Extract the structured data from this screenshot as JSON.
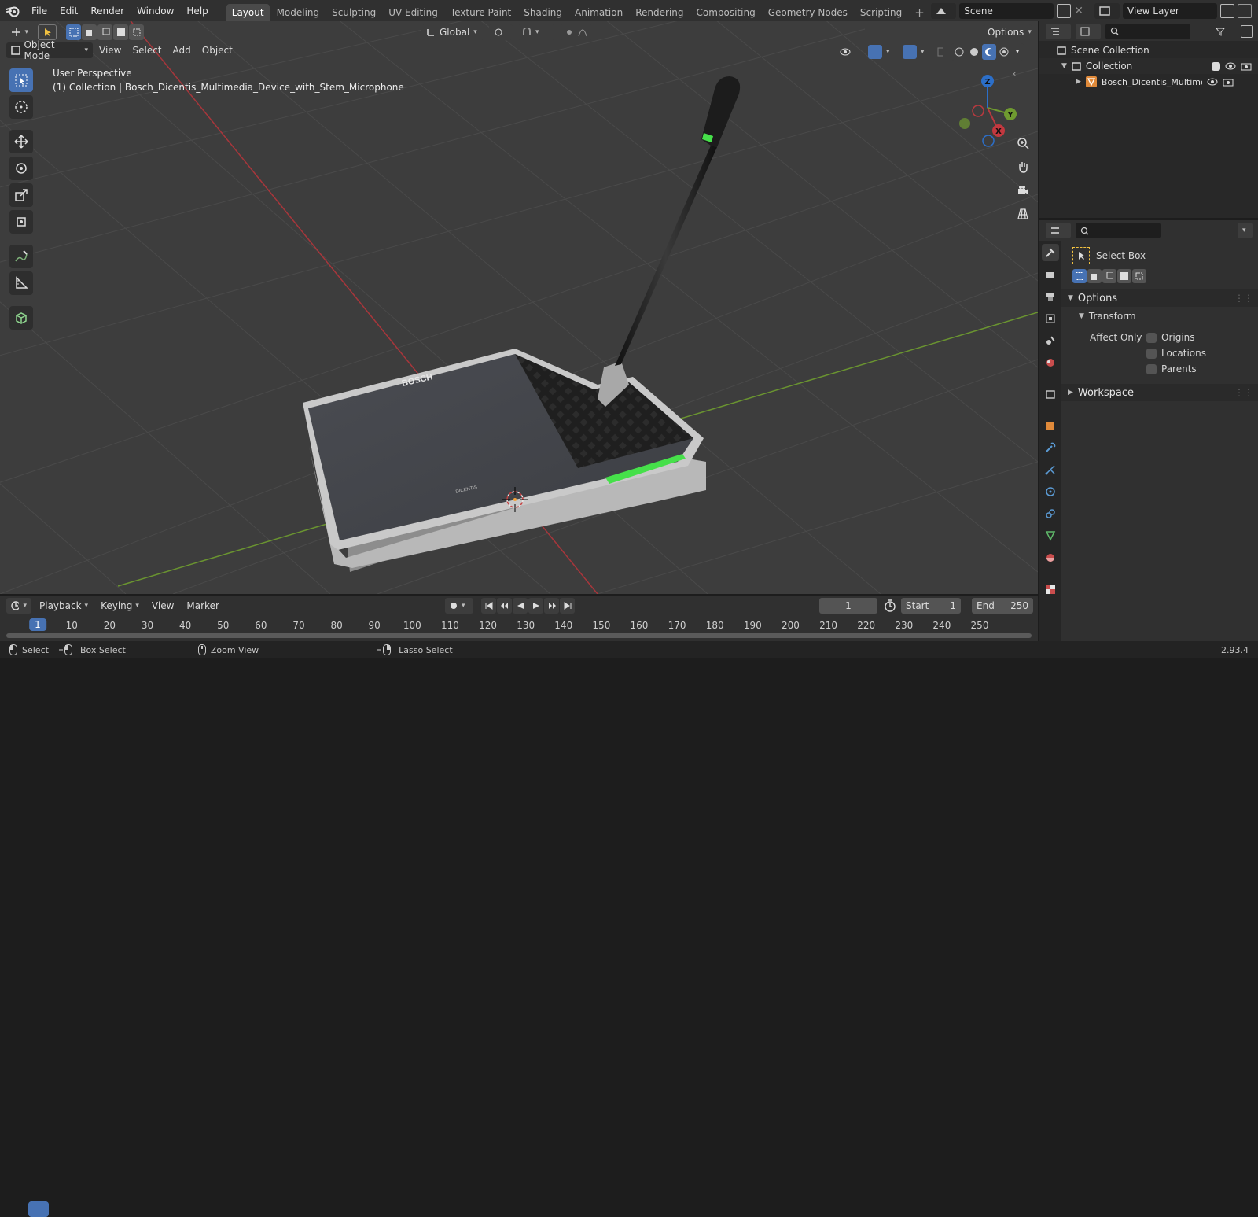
{
  "menus": [
    "File",
    "Edit",
    "Render",
    "Window",
    "Help"
  ],
  "workspaces": [
    "Layout",
    "Modeling",
    "Sculpting",
    "UV Editing",
    "Texture Paint",
    "Shading",
    "Animation",
    "Rendering",
    "Compositing",
    "Geometry Nodes",
    "Scripting"
  ],
  "active_workspace": "Layout",
  "scene": "Scene",
  "view_layer": "View Layer",
  "header": {
    "orientation": "Global",
    "options": "Options",
    "mode": "Object Mode",
    "menu": [
      "View",
      "Select",
      "Add",
      "Object"
    ]
  },
  "viewport": {
    "perspective": "User Perspective",
    "collection_info": "(1) Collection | Bosch_Dicentis_Multimedia_Device_with_Stem_Microphone",
    "device_brand": "BOSCH",
    "device_sub": "DICENTIS"
  },
  "gizmo": {
    "z": "Z",
    "y": "Y",
    "x": "X"
  },
  "outliner": {
    "root": "Scene Collection",
    "collection": "Collection",
    "object": "Bosch_Dicentis_Multimedia_Device_with_Stem_Microphone"
  },
  "properties": {
    "tool_name": "Select Box",
    "options": "Options",
    "transform": "Transform",
    "affect_only": "Affect Only",
    "origins": "Origins",
    "locations": "Locations",
    "parents": "Parents",
    "workspace": "Workspace"
  },
  "timeline": {
    "menu": [
      "Playback",
      "Keying",
      "View",
      "Marker"
    ],
    "current_frame": "1",
    "start_label": "Start",
    "start": "1",
    "end_label": "End",
    "end": "250",
    "ticks": [
      "1",
      "10",
      "20",
      "30",
      "40",
      "50",
      "60",
      "70",
      "80",
      "90",
      "100",
      "110",
      "120",
      "130",
      "140",
      "150",
      "160",
      "170",
      "180",
      "190",
      "200",
      "210",
      "220",
      "230",
      "240",
      "250"
    ]
  },
  "status": {
    "select": "Select",
    "box_select": "Box Select",
    "zoom_view": "Zoom View",
    "lasso_select": "Lasso Select",
    "version": "2.93.4"
  },
  "colors": {
    "accent": "#4772b3",
    "axis_x": "#b8393f",
    "axis_y": "#6f9a30",
    "led": "#46e04a"
  }
}
